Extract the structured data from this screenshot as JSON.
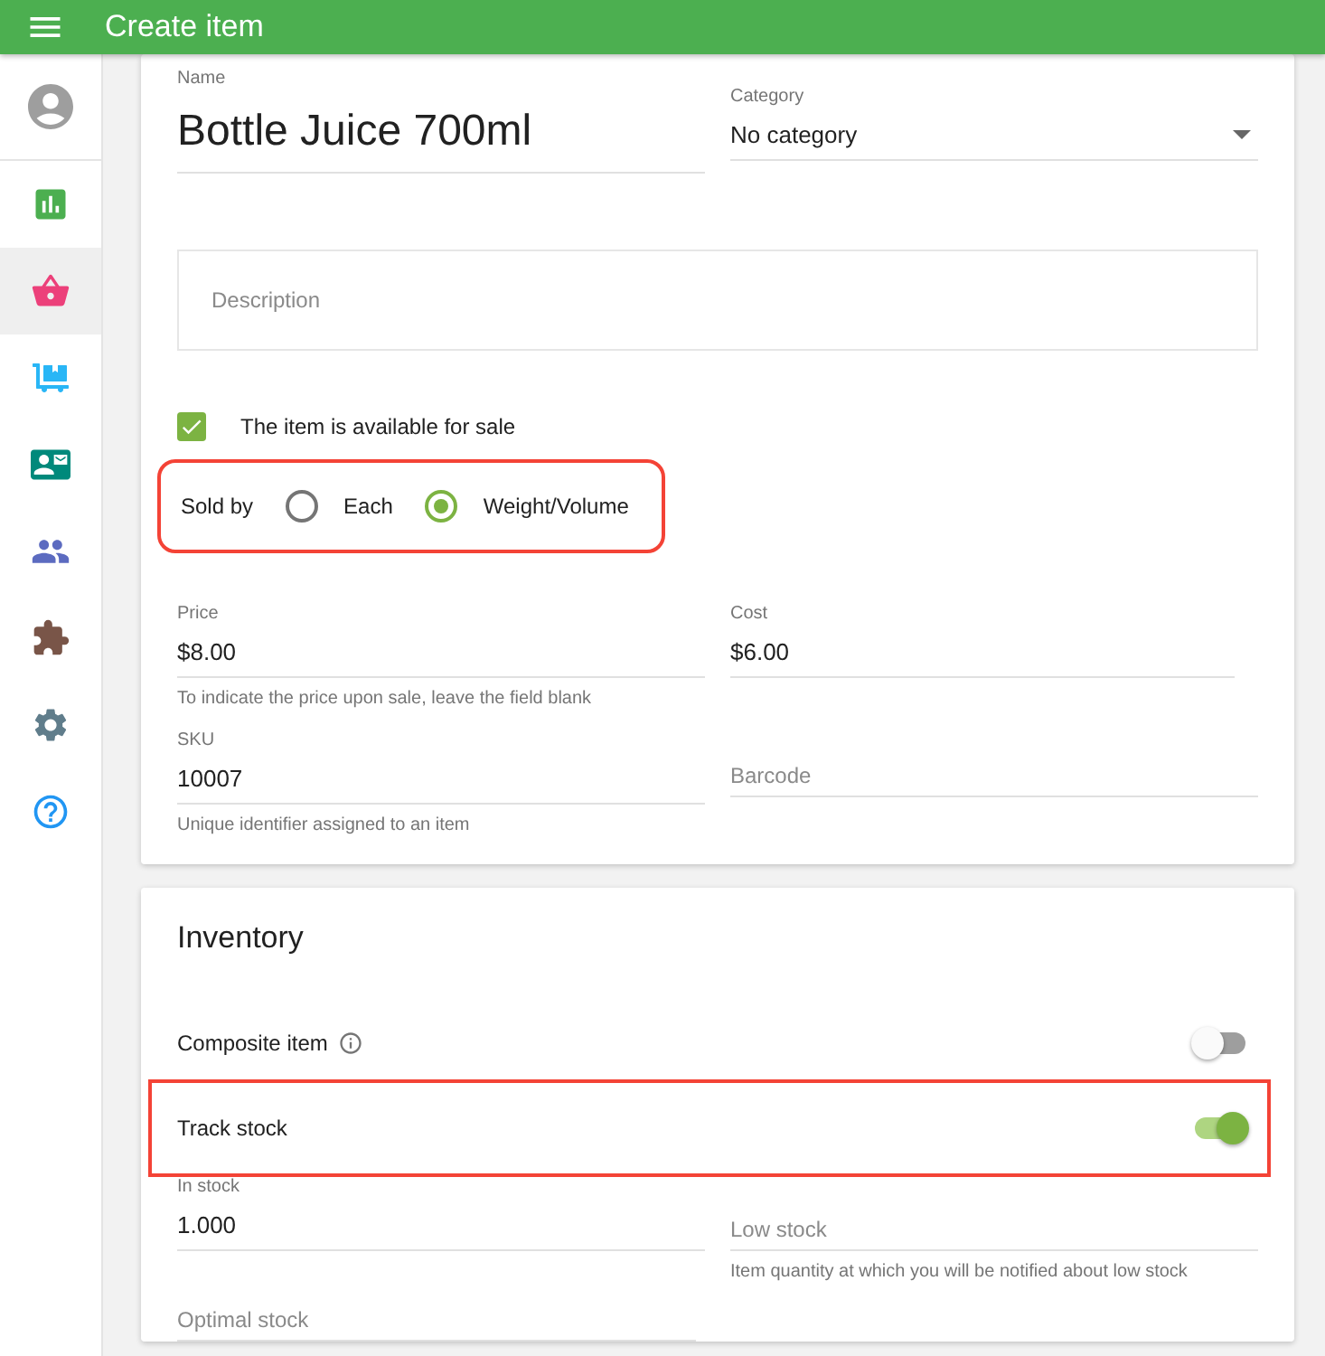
{
  "app_bar": {
    "title": "Create item"
  },
  "sidebar": {
    "items": [
      {
        "selected": false
      },
      {
        "selected": false
      },
      {
        "selected": true
      },
      {
        "selected": false
      },
      {
        "selected": false
      },
      {
        "selected": false
      },
      {
        "selected": false
      },
      {
        "selected": false
      },
      {
        "selected": false
      }
    ]
  },
  "item_form": {
    "name": {
      "label": "Name",
      "value": "Bottle Juice 700ml"
    },
    "category": {
      "label": "Category",
      "value": "No category"
    },
    "description": {
      "placeholder": "Description"
    },
    "available_for_sale": {
      "label": "The item is available for sale",
      "checked": true
    },
    "sold_by": {
      "label": "Sold by",
      "highlighted": true,
      "options": [
        {
          "label": "Each",
          "selected": false
        },
        {
          "label": "Weight/Volume",
          "selected": true
        }
      ]
    },
    "price": {
      "label": "Price",
      "value": "$8.00",
      "helper": "To indicate the price upon sale, leave the field blank"
    },
    "cost": {
      "label": "Cost",
      "value": "$6.00"
    },
    "sku": {
      "label": "SKU",
      "value": "10007",
      "helper": "Unique identifier assigned to an item"
    },
    "barcode": {
      "placeholder": "Barcode"
    }
  },
  "inventory": {
    "title": "Inventory",
    "composite_item": {
      "label": "Composite item",
      "on": false
    },
    "track_stock": {
      "label": "Track stock",
      "on": true,
      "highlighted": true
    },
    "in_stock": {
      "label": "In stock",
      "value": "1.000"
    },
    "low_stock": {
      "placeholder": "Low stock",
      "helper": "Item quantity at which you will be notified about low stock"
    },
    "optimal_stock": {
      "placeholder": "Optimal stock"
    }
  }
}
